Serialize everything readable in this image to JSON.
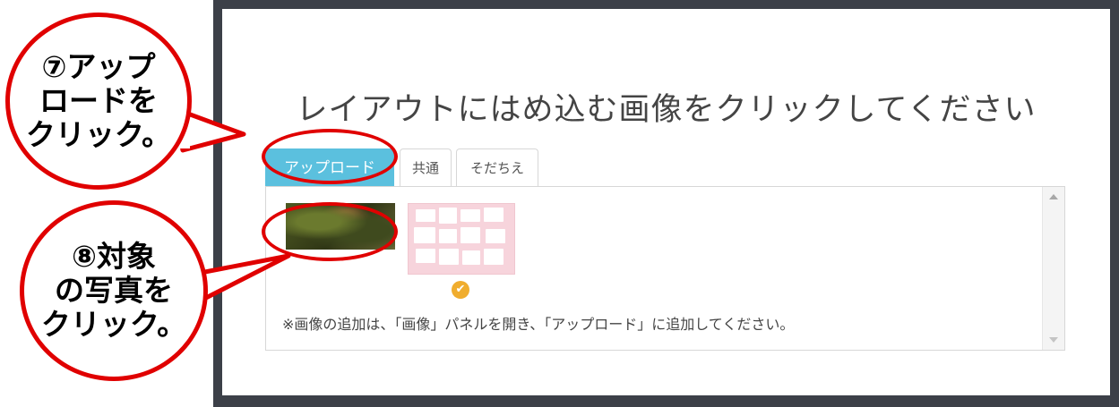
{
  "modal": {
    "title": "レイアウトにはめ込む画像をクリックしてください",
    "tabs": [
      {
        "label": "アップロード",
        "active": true
      },
      {
        "label": "共通",
        "active": false
      },
      {
        "label": "そだちえ",
        "active": false
      }
    ],
    "note": "※画像の追加は、「画像」パネルを開き、「アップロード」に追加してください。",
    "selected_check": "✔"
  },
  "callouts": [
    {
      "lines": [
        "⑦アップ",
        "ロードを",
        "クリック。"
      ]
    },
    {
      "lines": [
        "⑧対象",
        "の写真を",
        "クリック。"
      ]
    }
  ],
  "colors": {
    "accent": "#5bc0de",
    "annotation_red": "#e00000",
    "check": "#f0ad2e",
    "backdrop": "#3c4048"
  }
}
